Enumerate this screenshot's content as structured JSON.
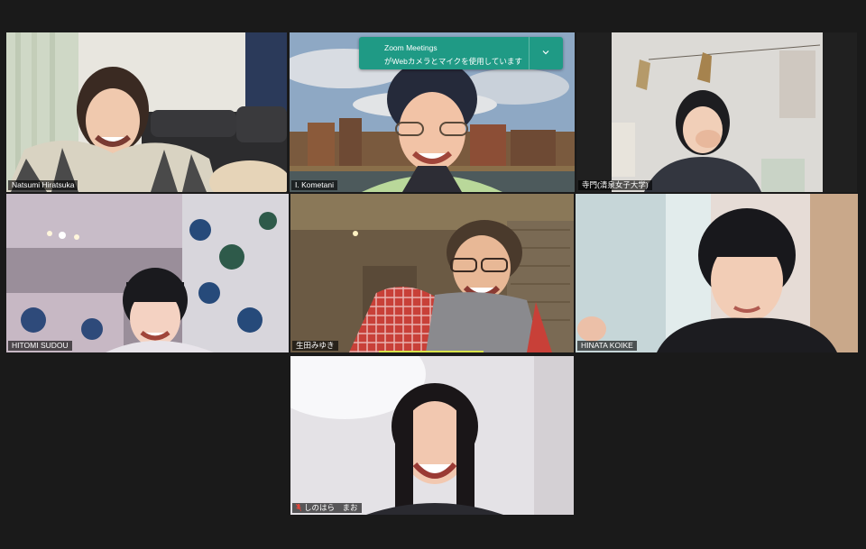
{
  "meeting": {
    "view": "gallery",
    "active_speaker": "I. Kometani"
  },
  "notification": {
    "title": "Zoom Meetings",
    "message": "がWebカメラとマイクを使用しています",
    "expand_icon": "chevron-down-icon"
  },
  "participants": [
    {
      "name": "Natsumi Hiratsuka",
      "muted": false
    },
    {
      "name": "I. Kometani",
      "muted": false
    },
    {
      "name": "寺門(清泉女子大学)",
      "muted": false
    },
    {
      "name": "HITOMI SUDOU",
      "muted": false
    },
    {
      "name": "生田みゆき",
      "muted": false
    },
    {
      "name": "HINATA KOIKE",
      "muted": false
    },
    {
      "name": "しのはら　まお",
      "muted": true
    }
  ],
  "colors": {
    "background": "#1a1a1a",
    "active_border": "#c7d931",
    "notification_bg": "#1f9a85",
    "muted_icon": "#e0453a"
  }
}
